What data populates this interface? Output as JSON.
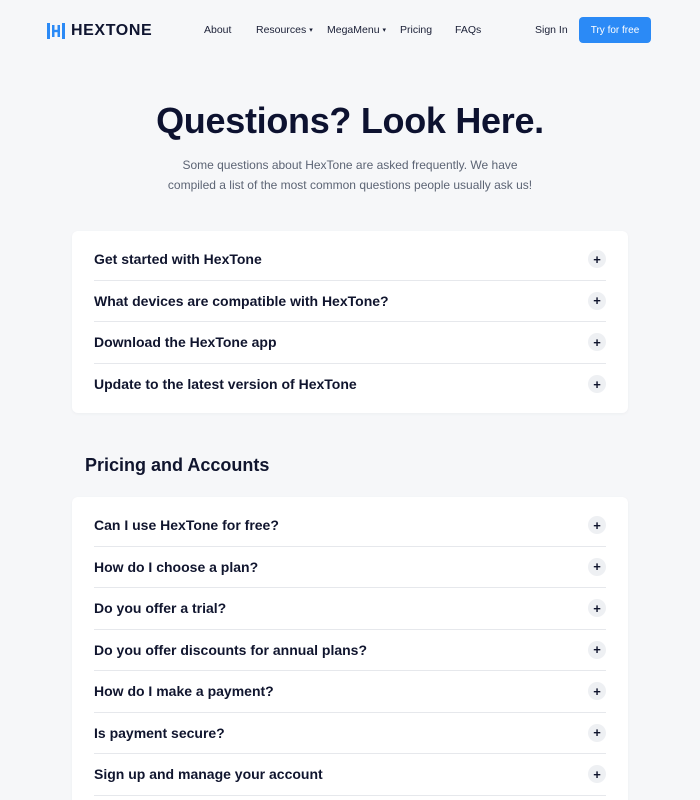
{
  "brand": {
    "name": "HEXTONE",
    "accent": "#2b8af6"
  },
  "nav": {
    "links": [
      {
        "label": "About",
        "caret": ""
      },
      {
        "label": "Resources",
        "caret": "▾"
      },
      {
        "label": "MegaMenu",
        "caret": "▾"
      },
      {
        "label": "Pricing",
        "caret": ""
      },
      {
        "label": "FAQs",
        "caret": ""
      }
    ],
    "signin": "Sign In",
    "cta": "Try for free"
  },
  "hero": {
    "title": "Questions? Look Here.",
    "subtitle": "Some questions about HexTone are asked frequently. We have compiled a list of the most common questions people usually ask us!"
  },
  "faq_general": [
    {
      "q": "Get started with HexTone",
      "icon": "+"
    },
    {
      "q": "What devices are compatible with HexTone?",
      "icon": "+"
    },
    {
      "q": "Download the HexTone app",
      "icon": "+"
    },
    {
      "q": "Update to the latest version of HexTone",
      "icon": "+"
    }
  ],
  "section_pricing": {
    "title": "Pricing and Accounts"
  },
  "faq_pricing": [
    {
      "q": "Can I use HexTone for free?",
      "icon": "+"
    },
    {
      "q": "How do I choose a plan?",
      "icon": "+"
    },
    {
      "q": "Do you offer a trial?",
      "icon": "+"
    },
    {
      "q": "Do you offer discounts for annual plans?",
      "icon": "+"
    },
    {
      "q": "How do I make a payment?",
      "icon": "+"
    },
    {
      "q": "Is payment secure?",
      "icon": "+"
    },
    {
      "q": "Sign up and manage your account",
      "icon": "+"
    }
  ]
}
